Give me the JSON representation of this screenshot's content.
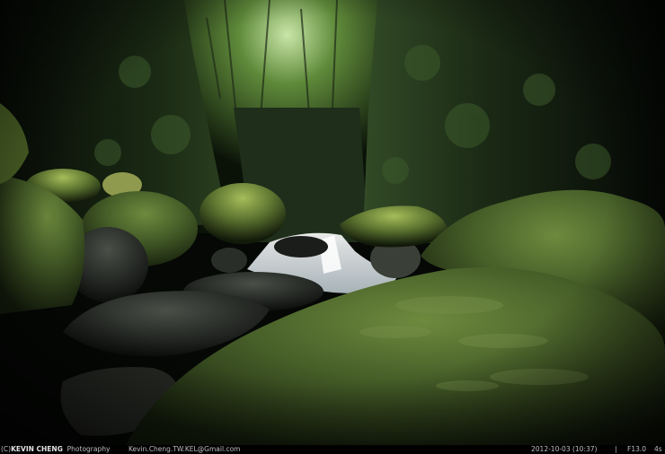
{
  "photo": {
    "subject": "mossy-boulders-waterfall-forest",
    "colors": {
      "background": "#000000",
      "moss": "#4f6a2a",
      "moss_highlight": "#8fae4a",
      "foliage": "#2e4a22",
      "water": "#e8eef2",
      "shadow": "#050805"
    }
  },
  "caption": {
    "copyright": "(C)",
    "author": "KEVIN CHENG",
    "role": "Photography",
    "email": "Kevin.Cheng.TW.KEL@Gmail.com",
    "datetime": "2012-10-03 (10:37)",
    "separator": "|",
    "aperture": "F13.0",
    "shutter": "4s"
  }
}
